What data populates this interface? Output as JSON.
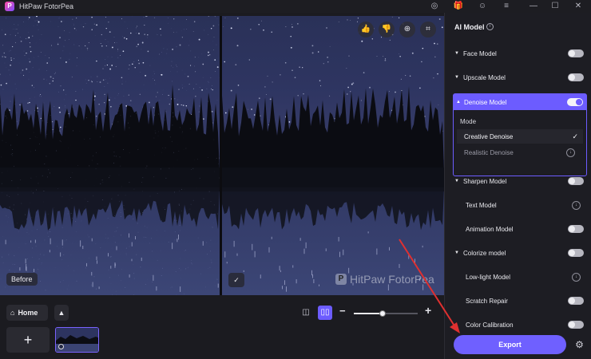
{
  "app": {
    "title": "HitPaw FotorPea",
    "logo_letter": "P"
  },
  "titlebar": {
    "icons": [
      "discord-icon",
      "gift-icon",
      "account-icon",
      "menu-icon",
      "minimize-icon",
      "maximize-icon",
      "close-icon"
    ],
    "glyphs": {
      "discord": "◎",
      "gift": "🎁",
      "account": "☺",
      "menu": "≡",
      "minimize": "—",
      "maximize": "☐",
      "close": "✕"
    }
  },
  "canvas": {
    "before_label": "Before",
    "after_check": "✓",
    "watermark": "HitPaw FotorPea",
    "watermark_logo": "P",
    "tools": [
      {
        "name": "like-icon",
        "glyph": "👍"
      },
      {
        "name": "dislike-icon",
        "glyph": "👎"
      },
      {
        "name": "zoom-icon",
        "glyph": "⊕"
      },
      {
        "name": "crop-icon",
        "glyph": "⌗"
      }
    ]
  },
  "bottombar": {
    "home_label": "Home",
    "home_glyph": "⌂",
    "up_glyph": "▲",
    "add_glyph": "+",
    "view_single_glyph": "◫",
    "view_split_glyph": "▯▯",
    "zoom_minus": "−",
    "zoom_plus": "+",
    "zoom_level": 0.45
  },
  "panel": {
    "title": "AI Model",
    "info_glyph": "i",
    "models": [
      {
        "label": "Face Model",
        "caret": "▼",
        "control": "toggle",
        "on": false
      },
      {
        "label": "Upscale Model",
        "caret": "▼",
        "control": "toggle",
        "on": false
      },
      {
        "label": "Denoise Model",
        "caret": "▲",
        "control": "toggle",
        "on": true
      },
      {
        "label": "Sharpen Model",
        "caret": "▼",
        "control": "toggle",
        "on": false
      },
      {
        "label": "Text Model",
        "caret": "",
        "control": "download",
        "on": false
      },
      {
        "label": "Animation Model",
        "caret": "",
        "control": "toggle",
        "on": false
      },
      {
        "label": "Colorize model",
        "caret": "▼",
        "control": "toggle",
        "on": false
      },
      {
        "label": "Low-light Model",
        "caret": "",
        "control": "download",
        "on": false
      },
      {
        "label": "Scratch Repair",
        "caret": "",
        "control": "toggle",
        "on": false
      },
      {
        "label": "Color Calibration",
        "caret": "",
        "control": "toggle",
        "on": false
      }
    ],
    "denoise": {
      "mode_label": "Mode",
      "options": [
        {
          "label": "Creative Denoise",
          "selected": true,
          "indicator": "✓"
        },
        {
          "label": "Realistic Denoise",
          "selected": false,
          "indicator": "↓"
        }
      ]
    },
    "download_glyph": "↓",
    "export_label": "Export",
    "settings_glyph": "⚙"
  },
  "colors": {
    "accent": "#6c5cff",
    "export": "#6f60ff",
    "annotation_arrow": "#e03030"
  }
}
